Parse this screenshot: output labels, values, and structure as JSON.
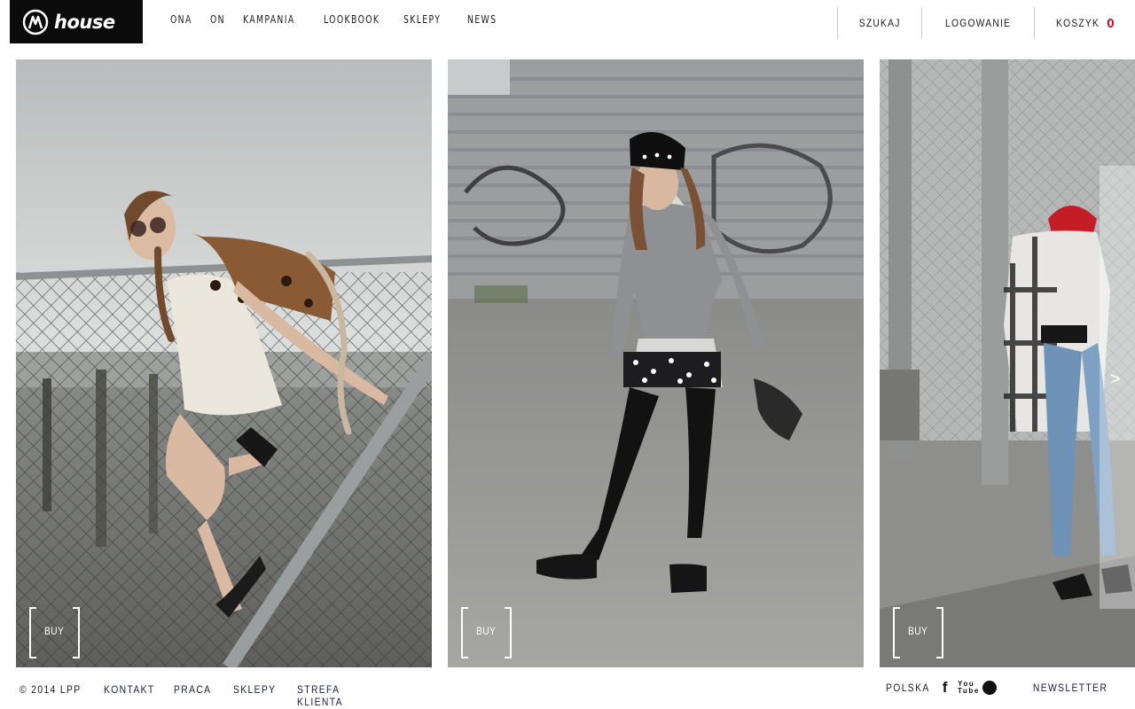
{
  "header": {
    "logo_text": "house",
    "nav": [
      "ONA",
      "ON",
      "KAMPANIA",
      "LOOKBOOK",
      "SKLEPY",
      "NEWS"
    ],
    "search_label": "SZUKAJ",
    "login_label": "LOGOWANIE",
    "cart_label": "KOSZYK",
    "cart_count": "0"
  },
  "panels": [
    {
      "buy_label": "BUY"
    },
    {
      "buy_label": "BUY"
    },
    {
      "buy_label": "BUY"
    }
  ],
  "footer": {
    "copyright": "© 2014 LPP",
    "links": [
      "KONTAKT",
      "PRACA",
      "SKLEPY",
      "STREFA KLIENTA"
    ],
    "language": "POLSKA",
    "social": [
      "facebook-icon",
      "youtube-icon",
      "pinterest-icon"
    ],
    "newsletter": "NEWSLETTER"
  },
  "colors": {
    "logo_bg": "#0b0b0b",
    "cart_count": "#e0001b",
    "text": "#1a1a1a"
  }
}
